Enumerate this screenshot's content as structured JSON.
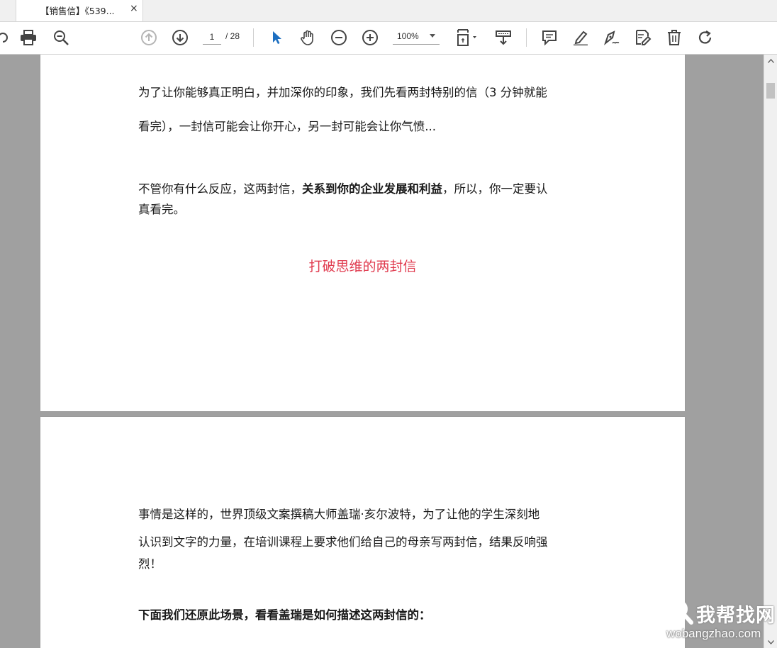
{
  "tab": {
    "title": "【销售信】《539...",
    "close": "×"
  },
  "toolbar": {
    "icons": [
      "share-icon",
      "print-icon",
      "zoom-search-icon",
      "prev-page-icon",
      "next-page-icon",
      "select-cursor-icon",
      "hand-tool-icon",
      "zoom-out-icon",
      "zoom-in-icon",
      "page-fit-icon",
      "scroll-mode-icon",
      "comment-icon",
      "highlight-icon",
      "sign-icon",
      "edit-pdf-icon",
      "delete-icon",
      "rotate-icon"
    ],
    "page_current": "1",
    "page_total": "/ 28",
    "zoom": "100%"
  },
  "page1": {
    "p1_line1": "为了让你能够真正明白，并加深你的印象，我们先看两封特别的信（3 分钟就能",
    "p1_line2": "看完），一封信可能会让你开心，另一封可能会让你气愤...",
    "p2_line1_a": "不管你有什么反应，这两封信，",
    "p2_line1_b": "关系到你的企业发展和利益",
    "p2_line1_c": "，所以，你一定要认",
    "p2_line2": "真看完。",
    "heading": "打破思维的两封信",
    "heading_color": "#e03a4e"
  },
  "page2": {
    "p1_line1": "事情是这样的，世界顶级文案撰稿大师盖瑞·亥尔波特，为了让他的学生深刻地",
    "p1_line2": "认识到文字的力量，在培训课程上要求他们给自己的母亲写两封信，结果反响强",
    "p1_line3": "烈！",
    "p2_bold": "下面我们还原此场景，看看盖瑞是如何描述这两封信的："
  },
  "watermark": {
    "text": "我帮找网",
    "url": "wobangzhao.com"
  }
}
